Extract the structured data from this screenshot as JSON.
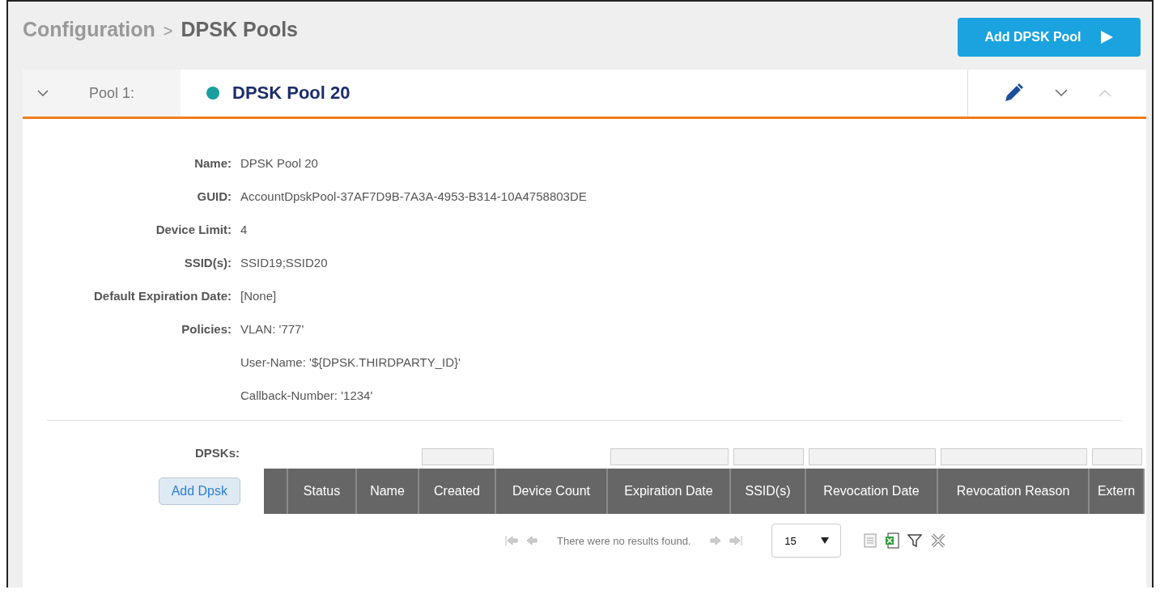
{
  "breadcrumb": {
    "parent": "Configuration",
    "separator": ">",
    "current": "DPSK Pools"
  },
  "add_button": {
    "label": "Add DPSK Pool"
  },
  "pool": {
    "label": "Pool 1:",
    "name": "DPSK Pool 20",
    "color": "#1a9e9e",
    "details": [
      {
        "label": "Name:",
        "values": [
          "DPSK Pool 20"
        ]
      },
      {
        "label": "GUID:",
        "values": [
          "AccountDpskPool-37AF7D9B-7A3A-4953-B314-10A4758803DE"
        ]
      },
      {
        "label": "Device Limit:",
        "values": [
          "4"
        ]
      },
      {
        "label": "SSID(s):",
        "values": [
          "SSID19;SSID20"
        ]
      },
      {
        "label": "Default Expiration Date:",
        "values": [
          "[None]"
        ]
      },
      {
        "label": "Policies:",
        "values": [
          "VLAN: '777'",
          "User-Name: '${DPSK.THIRDPARTY_ID}'",
          "Callback-Number: '1234'"
        ]
      }
    ],
    "dpsks": {
      "label": "DPSKs:",
      "add_button": "Add Dpsk",
      "columns": [
        {
          "label": "Status",
          "filter": false
        },
        {
          "label": "Name",
          "filter": false
        },
        {
          "label": "Created",
          "filter": true
        },
        {
          "label": "Device Count",
          "filter": false
        },
        {
          "label": "Expiration Date",
          "filter": true
        },
        {
          "label": "SSID(s)",
          "filter": true
        },
        {
          "label": "Revocation Date",
          "filter": true
        },
        {
          "label": "Revocation Reason",
          "filter": true
        },
        {
          "label": "Extern",
          "filter": true
        }
      ],
      "empty_message": "There were no results found.",
      "page_size": "15"
    }
  }
}
